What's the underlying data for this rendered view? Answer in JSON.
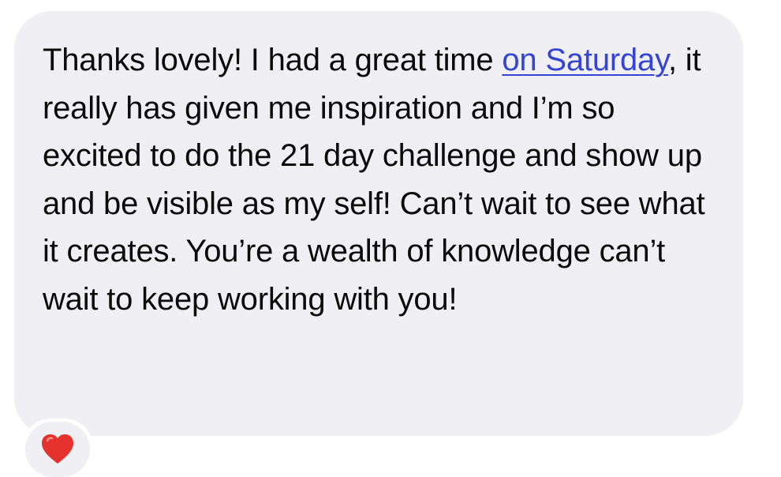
{
  "message": {
    "before_link": "Thanks lovely! I had a great time ",
    "link_text": "on Saturday",
    "after_link": ", it really has given me inspiration and I’m so excited to do the 21 day challenge and show up and be visible as my self! Can’t wait to see what it creates. You’re a wealth of knowledge can’t wait to keep working with you!"
  },
  "reaction": {
    "icon": "heart-icon",
    "color": "#e5322d"
  },
  "colors": {
    "bubble": "#efeff4",
    "text": "#0b0b0b",
    "link": "#3445d6"
  }
}
